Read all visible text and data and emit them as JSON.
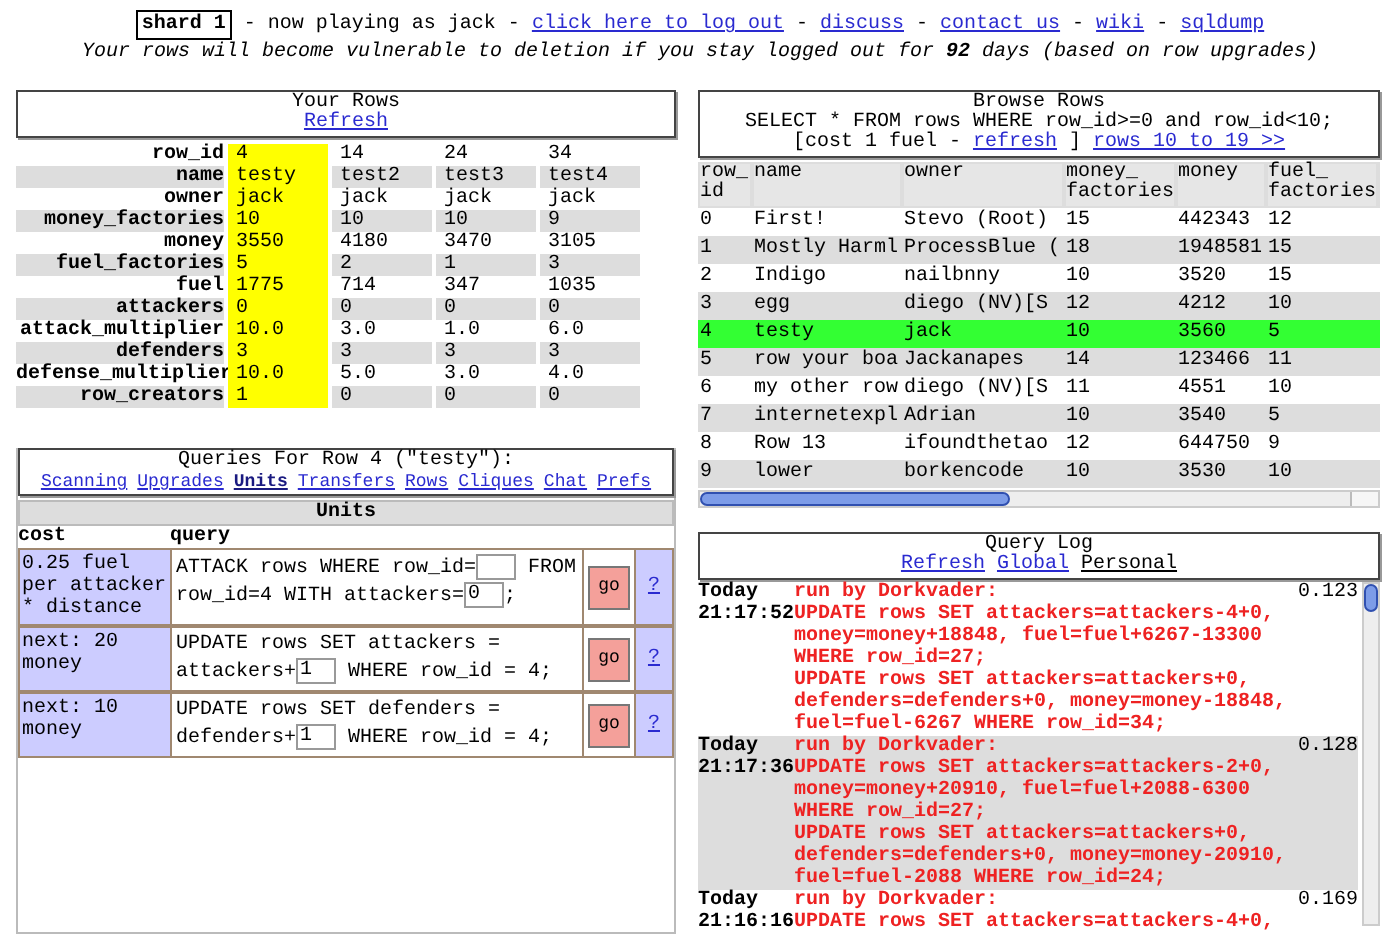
{
  "header": {
    "items": [
      {
        "kind": "badge",
        "text": "shard 1"
      },
      {
        "kind": "text",
        "text": "- now playing as jack -"
      },
      {
        "kind": "link",
        "text": "click here to log out"
      },
      {
        "kind": "text",
        "text": "-"
      },
      {
        "kind": "link",
        "text": "discuss"
      },
      {
        "kind": "text",
        "text": "-"
      },
      {
        "kind": "link",
        "text": "contact us"
      },
      {
        "kind": "text",
        "text": "-"
      },
      {
        "kind": "link",
        "text": "wiki"
      },
      {
        "kind": "text",
        "text": "-"
      },
      {
        "kind": "link",
        "text": "sqldump"
      }
    ],
    "warning": "Your rows will become vulnerable to deletion if you stay logged out for **92** days (based on row upgrades)"
  },
  "your_rows": {
    "title": "Your Rows",
    "refresh": "Refresh",
    "fields": [
      "row_id",
      "name",
      "owner",
      "money_factories",
      "money",
      "fuel_factories",
      "fuel",
      "attackers",
      "attack_multiplier",
      "defenders",
      "defense_multiplier",
      "row_creators"
    ],
    "columns": [
      {
        "selected": true,
        "values": [
          "4",
          "testy",
          "jack",
          "10",
          "3550",
          "5",
          "1775",
          "0",
          "10.0",
          "3",
          "10.0",
          "1"
        ]
      },
      {
        "selected": false,
        "values": [
          "14",
          "test2",
          "jack",
          "10",
          "4180",
          "2",
          "714",
          "0",
          "3.0",
          "3",
          "5.0",
          "0"
        ]
      },
      {
        "selected": false,
        "values": [
          "24",
          "test3",
          "jack",
          "10",
          "3470",
          "1",
          "347",
          "0",
          "1.0",
          "3",
          "3.0",
          "0"
        ]
      },
      {
        "selected": false,
        "values": [
          "34",
          "test4",
          "jack",
          "9",
          "3105",
          "3",
          "1035",
          "0",
          "6.0",
          "3",
          "4.0",
          "0"
        ]
      }
    ]
  },
  "queries": {
    "title": "Queries For Row 4 (\"testy\"):",
    "tabs": [
      {
        "label": "Scanning",
        "selected": false
      },
      {
        "label": "Upgrades",
        "selected": false
      },
      {
        "label": "Units",
        "selected": true
      },
      {
        "label": "Transfers",
        "selected": false
      },
      {
        "label": "Rows",
        "selected": false
      },
      {
        "label": "Cliques",
        "selected": false
      },
      {
        "label": "Chat",
        "selected": false
      },
      {
        "label": "Prefs",
        "selected": false
      }
    ],
    "section": "Units",
    "columns": [
      "cost",
      "query"
    ],
    "rows": [
      {
        "cost": "0.25 fuel per attacker * distance",
        "query": [
          {
            "kind": "text",
            "text": "ATTACK rows WHERE row_id="
          },
          {
            "kind": "input"
          },
          {
            "kind": "text",
            "text": " FROM"
          },
          {
            "kind": "break"
          },
          {
            "kind": "text",
            "text": "row_id=4 WITH attackers="
          },
          {
            "kind": "input",
            "value": "0"
          },
          {
            "kind": "text",
            "text": ";"
          }
        ],
        "button": "go",
        "help": "?"
      },
      {
        "cost": "next: 20 money",
        "query": [
          {
            "kind": "text",
            "text": "UPDATE rows SET attackers ="
          },
          {
            "kind": "break"
          },
          {
            "kind": "text",
            "text": "attackers+"
          },
          {
            "kind": "input",
            "value": "1"
          },
          {
            "kind": "text",
            "text": " WHERE row_id = 4;"
          }
        ],
        "button": "go",
        "help": "?"
      },
      {
        "cost": "next: 10 money",
        "query": [
          {
            "kind": "text",
            "text": "UPDATE rows SET defenders ="
          },
          {
            "kind": "break"
          },
          {
            "kind": "text",
            "text": "defenders+"
          },
          {
            "kind": "input",
            "value": "1"
          },
          {
            "kind": "text",
            "text": " WHERE row_id = 4;"
          }
        ],
        "button": "go",
        "help": "?"
      }
    ]
  },
  "browse": {
    "title": "Browse Rows",
    "query": "SELECT * FROM rows WHERE row_id>=0 and row_id<10;",
    "links": [
      {
        "kind": "text",
        "text": "[cost 1 fuel -"
      },
      {
        "kind": "link",
        "text": "refresh"
      },
      {
        "kind": "text",
        "text": "]"
      },
      {
        "kind": "link",
        "text": "rows 10 to 19 >>"
      }
    ],
    "columns": [
      "row_id",
      "name",
      "owner",
      "money_factories",
      "money",
      "fuel_factories"
    ],
    "rows": [
      {
        "selected": false,
        "cells": [
          "0",
          "First!",
          "Stevo (Root)",
          "15",
          "442343",
          "12"
        ]
      },
      {
        "selected": false,
        "cells": [
          "1",
          "Mostly Harml",
          "ProcessBlue (",
          "18",
          "1948581",
          "15"
        ]
      },
      {
        "selected": false,
        "cells": [
          "2",
          "Indigo",
          "nailbnny",
          "10",
          "3520",
          "15"
        ]
      },
      {
        "selected": false,
        "cells": [
          "3",
          "egg",
          "diego (NV)[S",
          "12",
          "4212",
          "10"
        ]
      },
      {
        "selected": true,
        "cells": [
          "4",
          "testy",
          "jack",
          "10",
          "3560",
          "5"
        ]
      },
      {
        "selected": false,
        "cells": [
          "5",
          "row your boa",
          "Jackanapes",
          "14",
          "123466",
          "11"
        ]
      },
      {
        "selected": false,
        "cells": [
          "6",
          "my other row",
          "diego (NV)[S",
          "11",
          "4551",
          "10"
        ]
      },
      {
        "selected": false,
        "cells": [
          "7",
          "internetexpl",
          "Adrian",
          "10",
          "3540",
          "5"
        ]
      },
      {
        "selected": false,
        "cells": [
          "8",
          "Row 13",
          "ifoundthetao",
          "12",
          "644750",
          "9"
        ]
      },
      {
        "selected": false,
        "cells": [
          "9",
          "lower",
          "borkencode",
          "10",
          "3530",
          "10"
        ]
      }
    ]
  },
  "query_log": {
    "title": "Query Log",
    "tabs": [
      {
        "label": "Refresh",
        "selected": false
      },
      {
        "label": "Global",
        "selected": false
      },
      {
        "label": "Personal",
        "selected": true
      }
    ],
    "entries": [
      {
        "day": "Today",
        "time": "21:17:52",
        "author": "run by Dorkvader:",
        "duration": "0.123",
        "lines": [
          "UPDATE rows SET attackers=attackers-4+0,",
          "money=money+18848, fuel=fuel+6267-13300",
          "WHERE row_id=27;",
          "UPDATE rows SET attackers=attackers+0,",
          "defenders=defenders+0, money=money-18848,",
          "fuel=fuel-6267 WHERE row_id=34;"
        ]
      },
      {
        "day": "Today",
        "time": "21:17:36",
        "author": "run by Dorkvader:",
        "duration": "0.128",
        "lines": [
          "UPDATE rows SET attackers=attackers-2+0,",
          "money=money+20910, fuel=fuel+2088-6300",
          "WHERE row_id=27;",
          "UPDATE rows SET attackers=attackers+0,",
          "defenders=defenders+0, money=money-20910,",
          "fuel=fuel-2088 WHERE row_id=24;"
        ]
      },
      {
        "day": "Today",
        "time": "21:16:16",
        "author": "run by Dorkvader:",
        "duration": "0.169",
        "lines": [
          "UPDATE rows SET attackers=attackers-4+0,"
        ]
      }
    ]
  }
}
